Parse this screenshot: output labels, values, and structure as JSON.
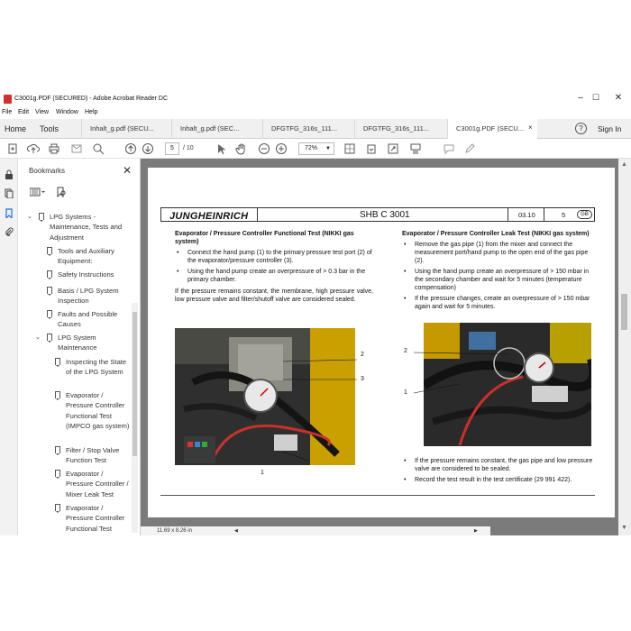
{
  "window": {
    "title": "C3001g.PDF (SECURED) - Adobe Acrobat Reader DC",
    "controls": [
      "–",
      "☐",
      "✕"
    ]
  },
  "menu": [
    "File",
    "Edit",
    "View",
    "Window",
    "Help"
  ],
  "tabs": {
    "home": "Home",
    "tools": "Tools",
    "documents": [
      "Inhalt_g.pdf (SECU...",
      "Inhalt_g.pdf (SEC...",
      "DFGTFG_316s_111...",
      "DFGTFG_316s_111...",
      "C3001g.PDF (SECU..."
    ],
    "close": "×",
    "help": "?",
    "sign_in": "Sign In"
  },
  "toolbar": {
    "page_current": "5",
    "page_total": "/ 10",
    "zoom": "72%"
  },
  "bookmarks": {
    "title": "Bookmarks",
    "close": "✕",
    "items": [
      {
        "label": "LPG Systems - Maintenance, Tests and Adjustment",
        "caret": "⌄"
      },
      {
        "label": "Tools and Auxiliary Equipment:"
      },
      {
        "label": "Safety Instructions"
      },
      {
        "label": "Basis / LPG System Inspection"
      },
      {
        "label": "Faults and Possible Causes"
      },
      {
        "label": "LPG System Maintenance",
        "caret": "⌄"
      },
      {
        "label": "Inspecting the State of the LPG System"
      },
      {
        "label": "Evaporator / Pressure Controller Functional Test (IMPCO gas system)"
      },
      {
        "label": "Filter / Stop Valve Function Test"
      },
      {
        "label": "Evaporator / Pressure Controller / Mixer Leak Test"
      },
      {
        "label": "Evaporator / Pressure Controller Functional Test"
      }
    ]
  },
  "document": {
    "logo": "JUNGHEINRICH",
    "reference": "SHB C 3001",
    "date": "03.10",
    "page": "5",
    "language": "GB",
    "left": {
      "heading": "Evaporator / Pressure Controller Functional Test (NIKKI gas system)",
      "bullets": [
        "Connect the hand pump (1) to the primary pressure test port (2) of the evaporator/pressure controller (3).",
        "Using the hand pump create an overpressure of > 0.3 bar in the primary chamber."
      ],
      "paragraph": "If the pressure remains constant, the membrane, high pressure valve, low pressure valve and filter/shutoff valve are considered sealed.",
      "callouts": [
        "2",
        "3",
        "1"
      ]
    },
    "right": {
      "heading": "Evaporator / Pressure Controller Leak Test (NIKKI gas system)",
      "bullets": [
        "Remove the gas pipe (1) from the mixer and connect the measurement port/hand pump to the open end of the gas pipe (2).",
        "Using the hand pump create an overpressure of > 150 mbar in the secondary chamber and wait for 5 minutes (temperature compensation)",
        "If the pressure changes, create an overpressure of > 150 mbar again and wait for 5 minutes."
      ],
      "bullets_after": [
        "If the pressure remains constant, the gas pipe and low pressure valve are considered to be sealed.",
        "Record the test result in the test certificate (29 991 422)."
      ],
      "callouts": [
        "2",
        "1"
      ]
    }
  },
  "status": {
    "page_size": "11.69 x 8.26 in"
  }
}
